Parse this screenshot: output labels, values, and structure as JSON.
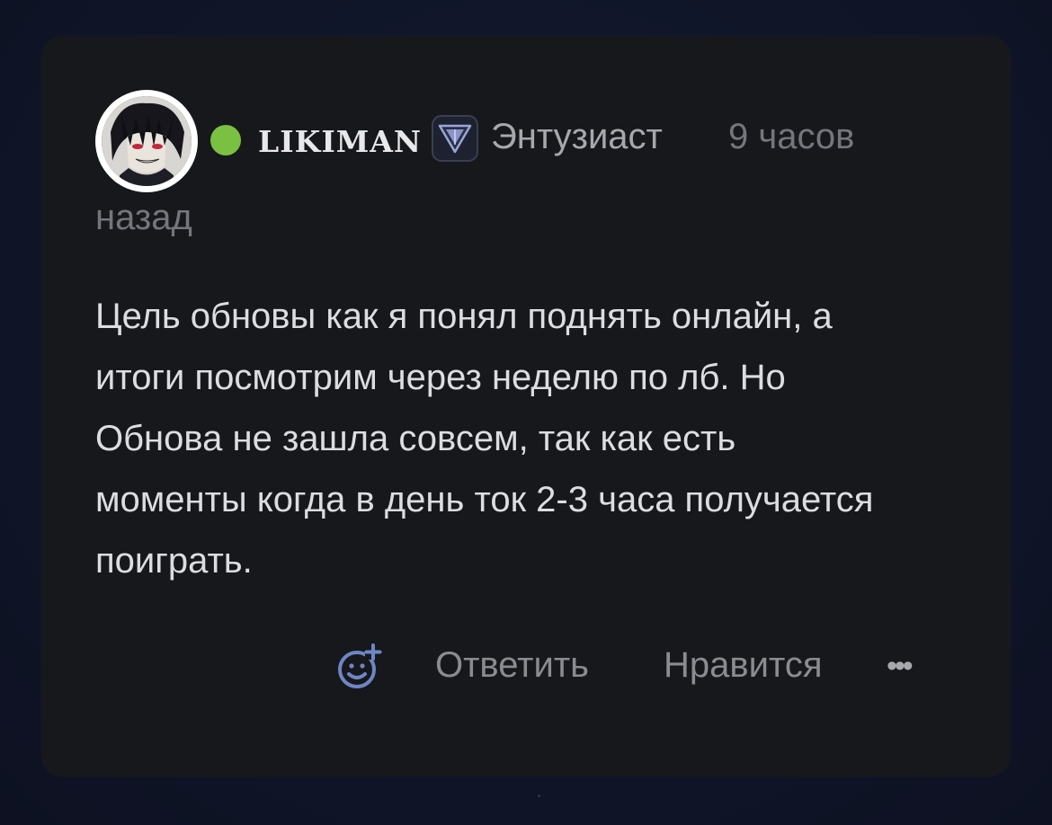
{
  "comment": {
    "author": {
      "username": "LIKIMAN",
      "status_color": "#7ac142",
      "rank_icon": "triangle-badge-icon",
      "rank_label": "Энтузиаст",
      "avatar_icon": "avatar-anime-character"
    },
    "time_part1": "9 часов",
    "time_part2": "назад",
    "text_lines": [
      "Цель обновы как я понял поднять онлайн, а",
      "итоги посмотрим через неделю по лб. Но",
      "Обнова не зашла совсем, так как есть",
      "моменты когда в день ток 2-3 часа получается",
      "поиграть."
    ]
  },
  "actions": {
    "react_icon": "add-emoji-icon",
    "reply_label": "Ответить",
    "like_label": "Нравится",
    "more_label": "•••"
  },
  "colors": {
    "background": "#101527",
    "card": "#17181c",
    "accent_icon": "#6e86c4"
  }
}
